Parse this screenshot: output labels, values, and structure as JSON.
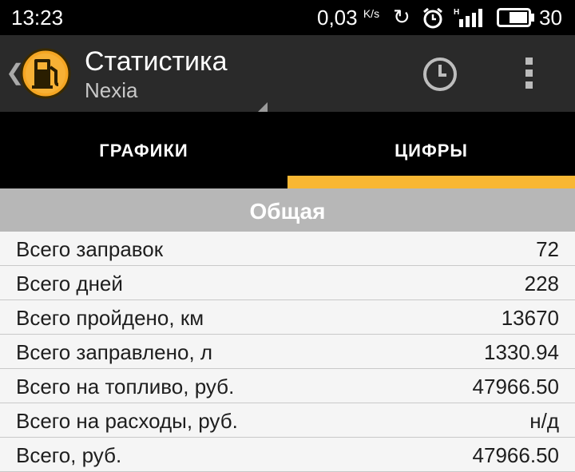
{
  "status_bar": {
    "time": "13:23",
    "speed_value": "0,03",
    "speed_unit": "K/s",
    "battery": "30"
  },
  "action_bar": {
    "title": "Статистика",
    "subtitle": "Nexia",
    "icons": [
      "fuel-pump-icon",
      "history-clock-icon",
      "overflow-menu-icon"
    ]
  },
  "tabs": [
    {
      "label": "ГРАФИКИ",
      "active": false
    },
    {
      "label": "ЦИФРЫ",
      "active": true
    }
  ],
  "section": {
    "title": "Общая"
  },
  "rows": [
    {
      "label": "Всего заправок",
      "value": "72"
    },
    {
      "label": "Всего дней",
      "value": "228"
    },
    {
      "label": "Всего пройдено, км",
      "value": "13670"
    },
    {
      "label": "Всего заправлено, л",
      "value": "1330.94"
    },
    {
      "label": "Всего на топливо, руб.",
      "value": "47966.50"
    },
    {
      "label": "Всего на расходы, руб.",
      "value": "н/д"
    },
    {
      "label": "Всего, руб.",
      "value": "47966.50"
    }
  ],
  "colors": {
    "accent": "#f8b733",
    "logo": "#f5a623",
    "actionbar": "#2a2a2a"
  }
}
